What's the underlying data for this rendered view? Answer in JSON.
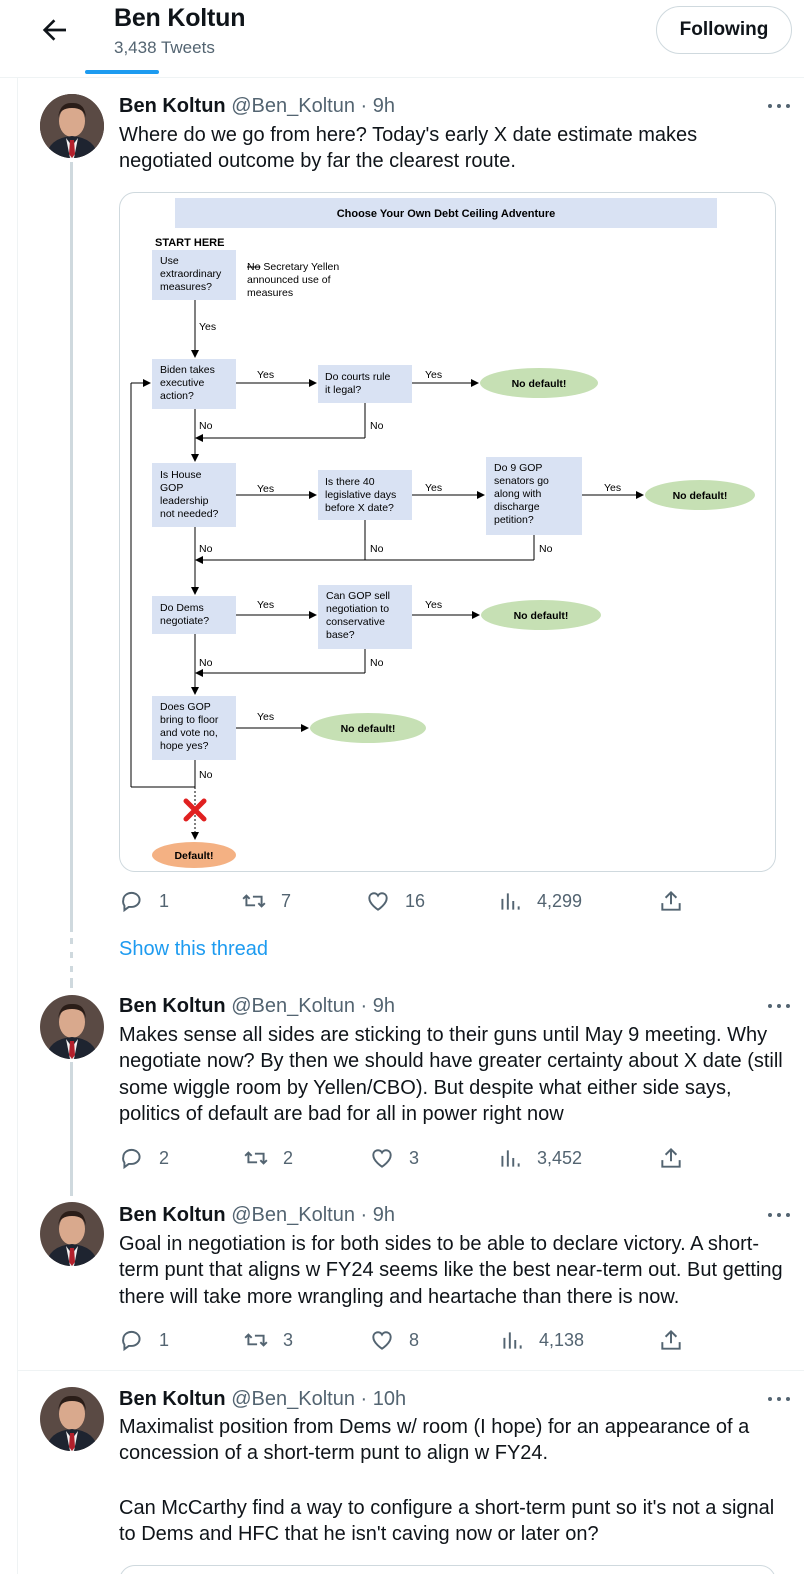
{
  "header": {
    "name": "Ben Koltun",
    "tweet_count": "3,438 Tweets",
    "follow_label": "Following",
    "back_icon": "arrow-left-icon"
  },
  "tweets": [
    {
      "name": "Ben Koltun",
      "handle": "@Ben_Koltun",
      "time": "9h",
      "text": "Where do we go from here? Today's early X date estimate makes negotiated outcome by far the clearest route.",
      "replies": "1",
      "retweets": "7",
      "likes": "16",
      "views": "4,299"
    },
    {
      "name": "Ben Koltun",
      "handle": "@Ben_Koltun",
      "time": "9h",
      "text": "Makes sense all sides are sticking to their guns until May 9 meeting. Why negotiate now? By then we should have greater certainty about X date (still some wiggle room by Yellen/CBO). But despite what either side says, politics of default are bad for all in power right now",
      "replies": "2",
      "retweets": "2",
      "likes": "3",
      "views": "3,452"
    },
    {
      "name": "Ben Koltun",
      "handle": "@Ben_Koltun",
      "time": "9h",
      "text": "Goal in negotiation is for both sides to be able to declare victory. A short-term punt that aligns w FY24 seems like the best near-term out. But getting there will take more wrangling and heartache than there is now.",
      "replies": "1",
      "retweets": "3",
      "likes": "8",
      "views": "4,138"
    },
    {
      "name": "Ben Koltun",
      "handle": "@Ben_Koltun",
      "time": "10h",
      "text1": "Maximalist position from Dems w/ room (I hope) for an appearance of a concession of a short-term punt to align w FY24.",
      "text2": "Can McCarthy find a way to configure a short-term punt so it's not a signal to Dems and HFC that he isn't caving now or later on?"
    }
  ],
  "show_thread": "Show this thread",
  "flowchart": {
    "title": "Choose Your Own Debt Ceiling Adventure",
    "start": "START HERE",
    "q1": [
      "Use",
      "extraordinary",
      "measures?"
    ],
    "note_strike": "No",
    "note": [
      " Secretary Yellen",
      "announced use of",
      "measures"
    ],
    "q2": [
      "Biden takes",
      "executive",
      "action?"
    ],
    "q3": [
      "Do courts rule",
      "it legal?"
    ],
    "q4": [
      "Is House",
      "GOP",
      "leadership",
      "not needed?"
    ],
    "q5": [
      "Is there 40",
      "legislative days",
      "before X date?"
    ],
    "q6": [
      "Do 9 GOP",
      "senators go",
      "along with",
      "discharge",
      "petition?"
    ],
    "q7": [
      "Do Dems",
      "negotiate?"
    ],
    "q8": [
      "Can GOP sell",
      "negotiation to",
      "conservative",
      "base?"
    ],
    "q9": [
      "Does GOP",
      "bring to floor",
      "and vote no,",
      "hope yes?"
    ],
    "yes": "Yes",
    "no": "No",
    "no_default": "No default!",
    "default": "Default!"
  }
}
